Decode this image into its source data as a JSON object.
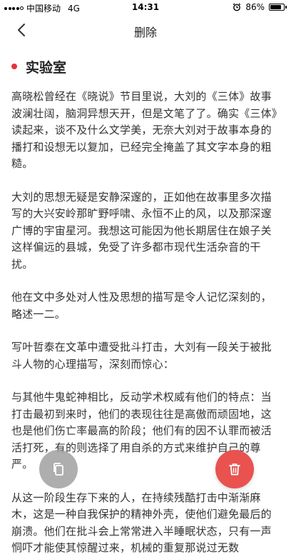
{
  "status_bar": {
    "carrier": "中国移动",
    "network": "4G",
    "time": "14:31",
    "battery_percent": "86%",
    "battery_level": 0.86,
    "signal_bars": 4,
    "signal_total": 5
  },
  "nav": {
    "title": "删除",
    "back_icon": "chevron-left-icon"
  },
  "section": {
    "title": "实验室",
    "dot_color": "#e8323c"
  },
  "paragraphs": [
    "高晓松曾经在《晓说》节目里说，大刘的《三体》故事波澜壮阔，脑洞异想天开，但是文笔了了。确实《三体》读起来，谈不及什么文学美，无奈大刘对于故事本身的播打和设想无以复加，已经完全掩盖了其文字本身的粗糙。",
    "大刘的思想无疑是安静深邃的，正如他在故事里多次描写的大兴安岭那旷野呼啸、永恒不止的风，以及那深邃广博的宇宙星河。我想这可能因为他长期居住在娘子关这样偏远的县城，免受了许多都市现代生活杂音的干扰。",
    "他在文中多处对人性及思想的描写是令人记忆深刻的，略述一二。",
    "写叶哲泰在文革中遭受批斗打击，大刘有一段关于被批斗人物的心理描写，深刻而惊心：",
    "与其他牛鬼蛇神相比，反动学术权威有他们的特点：当打击最初到来时，他们的表现往往是高傲而顽固地，这也是他们伤亡率最高的阶段；他们有的因不认罪而被活活打死，有的则选择了用自杀的方式来维护自己的尊严。",
    "从这一阶段生存下来的人，在持续残酷打击中渐渐麻木，这是一种自我保护的精神外壳，使他们避免最后的崩溃。他们在批斗会上常常进入半睡眠状态，只有一声恫吓才能使其惊醒过来，机械的重复那说过无数"
  ],
  "fabs": {
    "copy_icon": "copy-icon",
    "delete_icon": "trash-icon",
    "delete_color": "#e9524f"
  }
}
